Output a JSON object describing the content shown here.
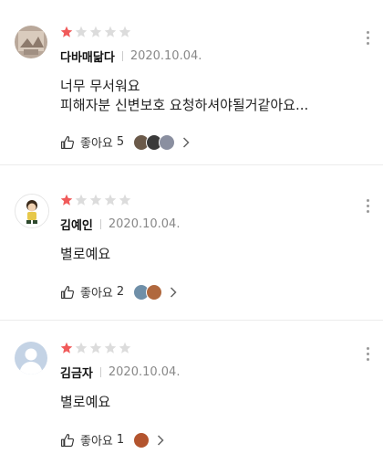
{
  "icons": {
    "star_filled": "#f05a5a",
    "star_empty": "#dcdcdc"
  },
  "reviews": [
    {
      "author": "다바매닮다",
      "date": "2020.10.04.",
      "rating": 1,
      "text": "너무 무서워요\n피해자분 신변보호 요청하셔야될거같아요...",
      "like_label": "좋아요",
      "like_count": "5"
    },
    {
      "author": "김예인",
      "date": "2020.10.04.",
      "rating": 1,
      "text": "별로예요",
      "like_label": "좋아요",
      "like_count": "2"
    },
    {
      "author": "김금자",
      "date": "2020.10.04.",
      "rating": 1,
      "text": "별로예요",
      "like_label": "좋아요",
      "like_count": "1"
    }
  ]
}
